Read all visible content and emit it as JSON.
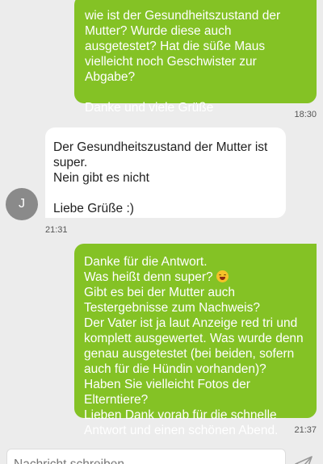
{
  "messages": [
    {
      "direction": "outgoing",
      "text": "wie ist der Gesundheitszustand der Mutter? Wurde diese auch ausgetestet? Hat die süße Maus vielleicht noch Geschwister zur Abgabe?\n\nDanke und viele Grüße",
      "time": "18:30"
    },
    {
      "direction": "incoming",
      "text": "Der Gesundheitszustand der Mutter ist super.\nNein gibt es nicht\n\nLiebe Grüße :)",
      "time": "21:31",
      "avatar_initial": "J"
    },
    {
      "direction": "outgoing",
      "text_before_emoji": "Danke für die Antwort.\nWas heißt denn super? ",
      "emoji": "grinning-sweat-face",
      "text_after_emoji": "\nGibt es bei der Mutter auch Testergebnisse zum Nachweis?\nDer Vater ist ja laut Anzeige red tri und komplett ausgewertet. Was wurde denn genau ausgetestet (bei beiden, sofern auch für die Hündin vorhanden)?\nHaben Sie vielleicht Fotos der Elterntiere?\nLieben Dank vorab für die schnelle Antwort und einen schönen Abend.",
      "time": "21:37"
    }
  ],
  "composer": {
    "placeholder": "Nachricht schreiben",
    "send_icon": "send-icon"
  },
  "colors": {
    "background": "#ececec",
    "outgoing_bubble": "#84c225",
    "incoming_bubble": "#ffffff",
    "avatar": "#8a8a8a"
  }
}
